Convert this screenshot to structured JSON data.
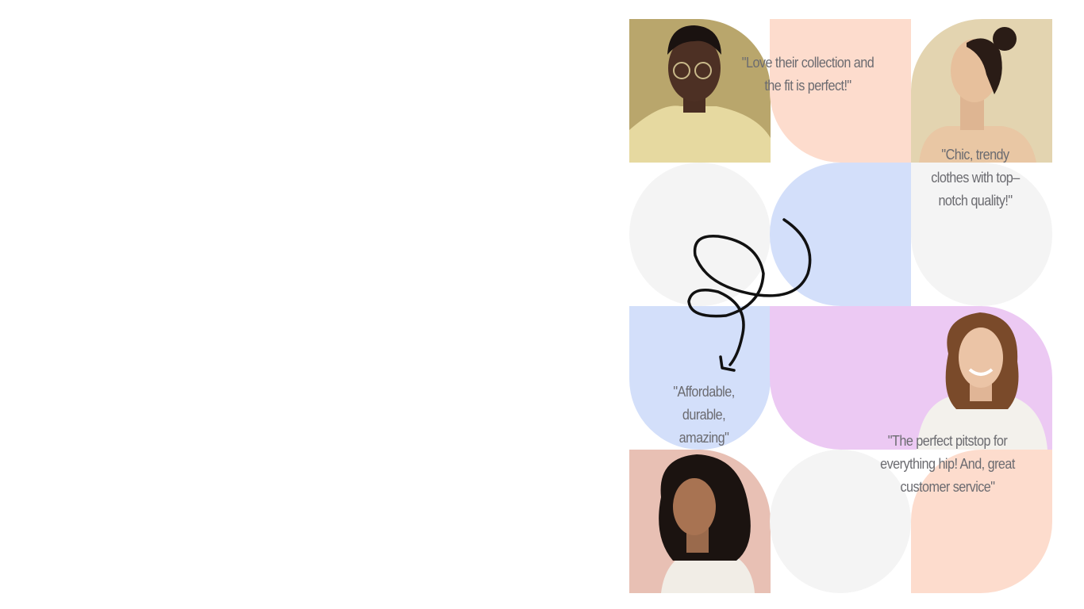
{
  "testimonials": [
    {
      "quote": "\"Love their collection and the fit is perfect!\""
    },
    {
      "quote": "\"Chic, trendy clothes with top–notch quality!\""
    },
    {
      "quote": "\"Affordable, durable, amazing\""
    },
    {
      "quote": "\"The perfect pitstop for everything hip! And, great customer service\""
    }
  ],
  "colors": {
    "peach": "#fddccd",
    "blue": "#d3dffa",
    "gray": "#f4f4f4",
    "purple": "#ecc9f3",
    "pink": "#e8c0b4",
    "olive": "#b9a66c",
    "beige": "#e3d4b0",
    "text": "#6b6b70"
  }
}
